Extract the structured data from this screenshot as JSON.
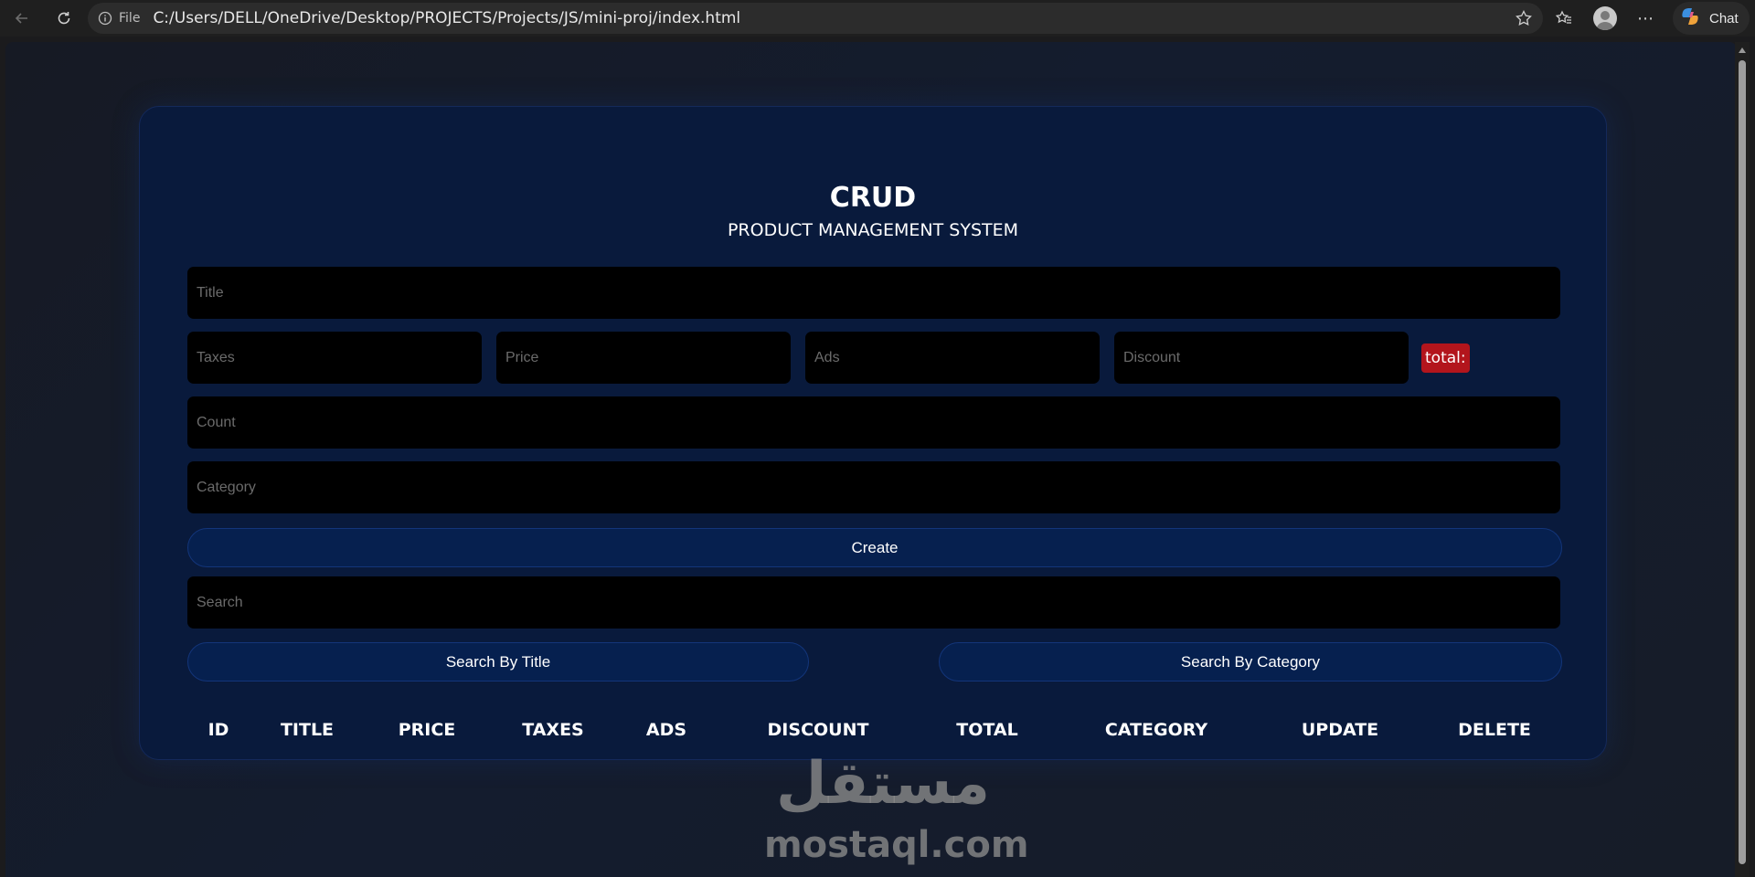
{
  "browser": {
    "file_label": "File",
    "url": "C:/Users/DELL/OneDrive/Desktop/PROJECTS/Projects/JS/mini-proj/index.html",
    "chat_label": "Chat",
    "more_label": "⋯"
  },
  "app": {
    "title": "CRUD",
    "subtitle": "PRODUCT MANAGEMENT SYSTEM",
    "inputs": {
      "title": "Title",
      "taxes": "Taxes",
      "price": "Price",
      "ads": "Ads",
      "discount": "Discount",
      "count": "Count",
      "category": "Category",
      "search": "Search"
    },
    "total_label": "total:",
    "create_label": "Create",
    "search_by_title": "Search By Title",
    "search_by_category": "Search By Category",
    "table_headers": [
      "ID",
      "TITLE",
      "PRICE",
      "TAXES",
      "ADS",
      "DISCOUNT",
      "TOTAL",
      "CATEGORY",
      "UPDATE",
      "DELETE"
    ],
    "colors": {
      "card_bg": "#091a3c",
      "button_bg": "#06204f",
      "total_badge": "#b3151c",
      "input_bg": "#000000"
    }
  },
  "watermark": {
    "arabic": "مستقل",
    "latin": "mostaql.com"
  }
}
